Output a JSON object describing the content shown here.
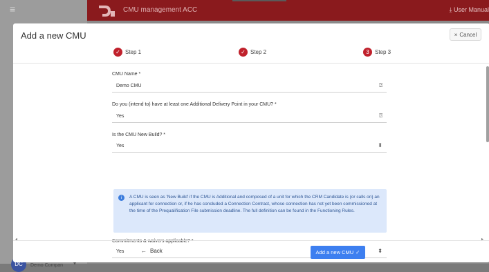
{
  "app": {
    "title": "CMU management ACC",
    "user_manual": "User Manual",
    "company": "Demo Compan"
  },
  "modal": {
    "title": "Add a new CMU",
    "cancel_label": "Cancel",
    "steps": [
      {
        "label": "Step 1",
        "status": "done"
      },
      {
        "label": "Step 2",
        "status": "done"
      },
      {
        "label": "Step 3",
        "status": "current",
        "number": "3"
      }
    ],
    "fields": [
      {
        "label": "CMU Name *",
        "value": "Demo CMU",
        "icon": "help-icon"
      },
      {
        "label": "Do you (intend to) have at least one Additional Delivery Point in your CMU? *",
        "value": "Yes",
        "icon": "help-icon"
      },
      {
        "label": "Is the CMU New Build? *",
        "value": "Yes",
        "icon": "select-caret-icon"
      },
      {
        "label": "Commitments & waivers applicable? *",
        "value": "Yes",
        "icon": "select-caret-icon"
      }
    ],
    "info": "A CMU is seen as 'New Build' if the CMU is Additional and composed of a unit for which the CRM Candidate is (or calls on) an applicant for connection or, if he has concluded a Connection Contract, whose connection has not yet been commissioned at the time of the Prequalification File submission deadline. The full definition can be found in the Functioning Rules.",
    "back_label": "Back",
    "submit_label": "Add a new CMU"
  },
  "colors": {
    "brand": "#8a1a1d",
    "step_red": "#c0212c",
    "primary": "#3d7ff0",
    "info_bg": "#dce8fb"
  }
}
